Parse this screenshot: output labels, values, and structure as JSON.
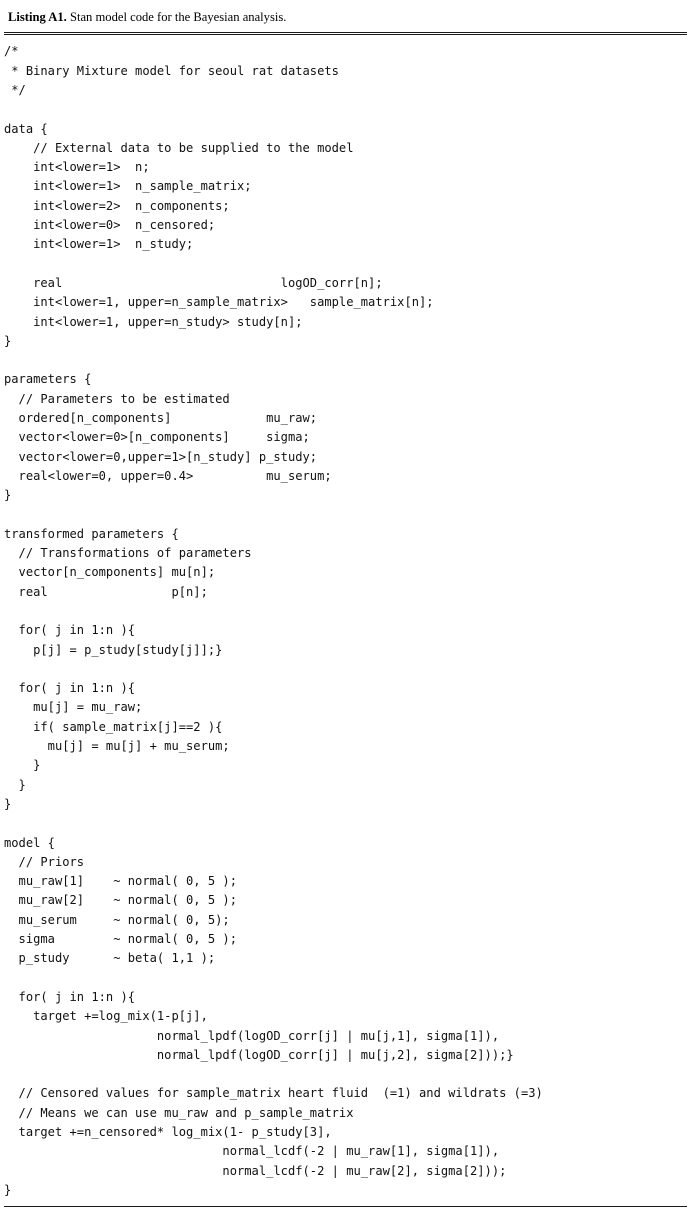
{
  "caption": {
    "label": "Listing A1.",
    "text": " Stan model code for the Bayesian analysis."
  },
  "code": {
    "language": "stan",
    "lines": [
      "/*",
      " * Binary Mixture model for seoul rat datasets",
      " */",
      "",
      "data {",
      "    // External data to be supplied to the model",
      "    int<lower=1>  n;",
      "    int<lower=1>  n_sample_matrix;",
      "    int<lower=2>  n_components;",
      "    int<lower=0>  n_censored;",
      "    int<lower=1>  n_study;",
      "",
      "    real                              logOD_corr[n];",
      "    int<lower=1, upper=n_sample_matrix>   sample_matrix[n];",
      "    int<lower=1, upper=n_study> study[n];",
      "}",
      "",
      "parameters {",
      "  // Parameters to be estimated",
      "  ordered[n_components]             mu_raw;",
      "  vector<lower=0>[n_components]     sigma;",
      "  vector<lower=0,upper=1>[n_study] p_study;",
      "  real<lower=0, upper=0.4>          mu_serum;",
      "}",
      "",
      "transformed parameters {",
      "  // Transformations of parameters",
      "  vector[n_components] mu[n];",
      "  real                 p[n];",
      "",
      "  for( j in 1:n ){",
      "    p[j] = p_study[study[j]];}",
      "",
      "  for( j in 1:n ){",
      "    mu[j] = mu_raw;",
      "    if( sample_matrix[j]==2 ){",
      "      mu[j] = mu[j] + mu_serum;",
      "    }",
      "  }",
      "}",
      "",
      "model {",
      "  // Priors",
      "  mu_raw[1]    ~ normal( 0, 5 );",
      "  mu_raw[2]    ~ normal( 0, 5 );",
      "  mu_serum     ~ normal( 0, 5);",
      "  sigma        ~ normal( 0, 5 );",
      "  p_study      ~ beta( 1,1 );",
      "",
      "  for( j in 1:n ){",
      "    target +=log_mix(1-p[j],",
      "                     normal_lpdf(logOD_corr[j] | mu[j,1], sigma[1]),",
      "                     normal_lpdf(logOD_corr[j] | mu[j,2], sigma[2]));}",
      "",
      "  // Censored values for sample_matrix heart fluid  (=1) and wildrats (=3)",
      "  // Means we can use mu_raw and p_sample_matrix",
      "  target +=n_censored* log_mix(1- p_study[3],",
      "                              normal_lcdf(-2 | mu_raw[1], sigma[1]),",
      "                              normal_lcdf(-2 | mu_raw[2], sigma[2]));",
      "}"
    ]
  }
}
